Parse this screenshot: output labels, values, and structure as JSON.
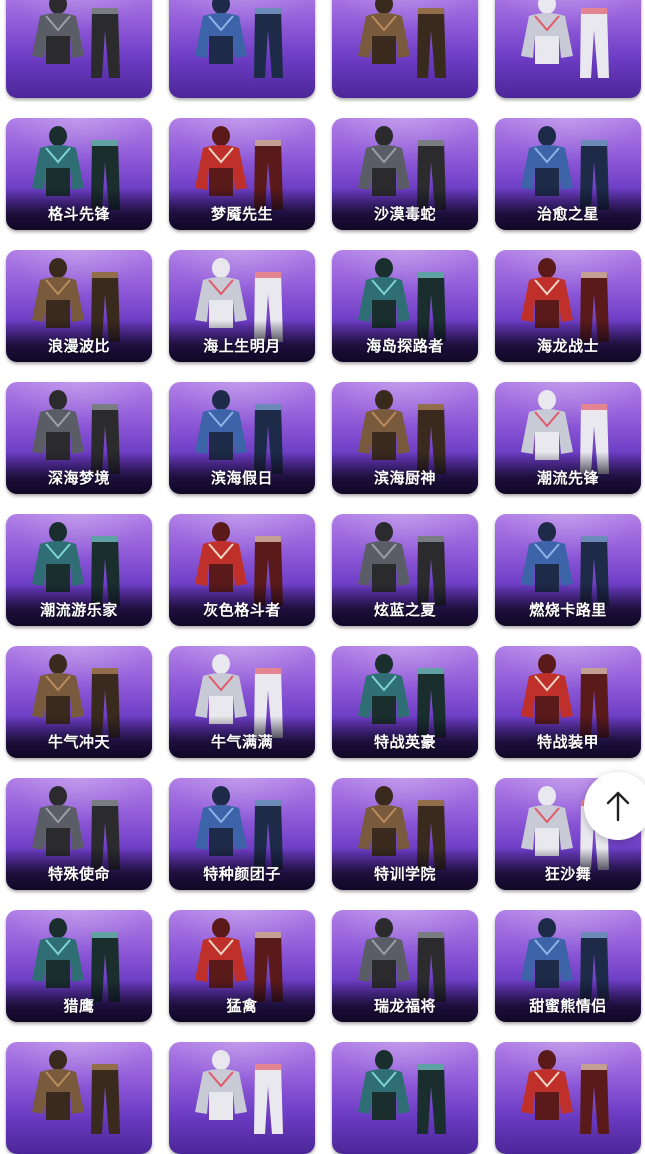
{
  "cards": [
    {
      "label": ""
    },
    {
      "label": ""
    },
    {
      "label": ""
    },
    {
      "label": ""
    },
    {
      "label": "格斗先锋"
    },
    {
      "label": "梦魇先生"
    },
    {
      "label": "沙漠毒蛇"
    },
    {
      "label": "治愈之星"
    },
    {
      "label": "浪漫波比"
    },
    {
      "label": "海上生明月"
    },
    {
      "label": "海岛探路者"
    },
    {
      "label": "海龙战士"
    },
    {
      "label": "深海梦境"
    },
    {
      "label": "滨海假日"
    },
    {
      "label": "滨海厨神"
    },
    {
      "label": "潮流先锋"
    },
    {
      "label": "潮流游乐家"
    },
    {
      "label": "灰色格斗者"
    },
    {
      "label": "炫蓝之夏"
    },
    {
      "label": "燃烧卡路里"
    },
    {
      "label": "牛气冲天"
    },
    {
      "label": "牛气满满"
    },
    {
      "label": "特战英豪"
    },
    {
      "label": "特战装甲"
    },
    {
      "label": "特殊使命"
    },
    {
      "label": "特种颜团子"
    },
    {
      "label": "特训学院"
    },
    {
      "label": "狂沙舞"
    },
    {
      "label": "猎鹰"
    },
    {
      "label": "猛禽"
    },
    {
      "label": "瑞龙福将"
    },
    {
      "label": "甜蜜熊情侣"
    },
    {
      "label": ""
    },
    {
      "label": ""
    },
    {
      "label": ""
    },
    {
      "label": ""
    }
  ],
  "back_to_top": {
    "icon": "arrow-up-icon"
  }
}
